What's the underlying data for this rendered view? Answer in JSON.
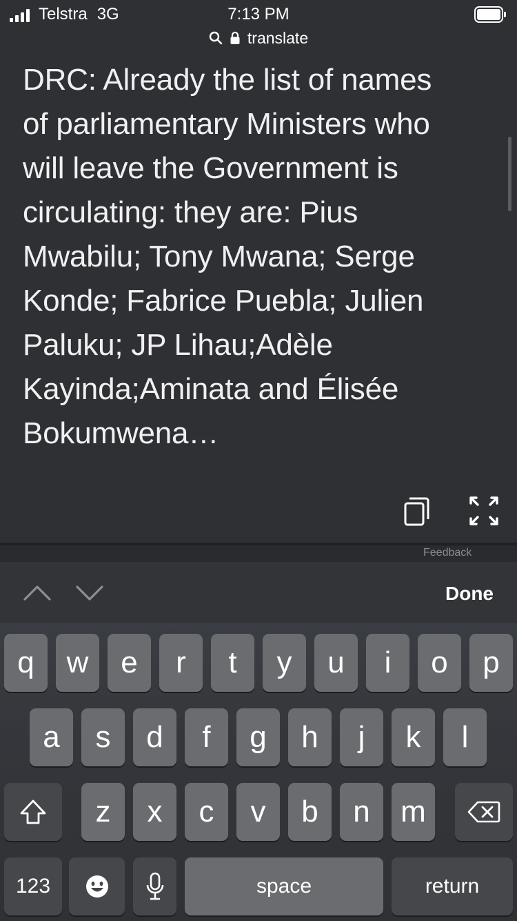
{
  "status_bar": {
    "carrier": "Telstra",
    "network": "3G",
    "time": "7:13 PM",
    "url": "translate"
  },
  "translation": {
    "text": "DRC: Already the list of names of parliamentary Ministers who will leave the Government is circulating: they are: Pius Mwabilu; Tony Mwana; Serge Konde; Fabrice Puebla; Julien Paluku; JP Lihau;Adèle Kayinda;Aminata and Élisée Bokumwena…",
    "lines": [
      "DRC: Already the list of names",
      "of parliamentary Ministers who",
      "will leave the Government is",
      "circulating: they are: Pius",
      "Mwabilu; Tony Mwana; Serge",
      "Konde; Fabrice Puebla; Julien",
      "Paluku; JP Lihau;Adèle",
      "Kayinda;Aminata and Élisée",
      "Bokumwena…"
    ],
    "feedback_partial": "Feedback"
  },
  "accessory_bar": {
    "done_label": "Done"
  },
  "keyboard": {
    "row1": [
      "q",
      "w",
      "e",
      "r",
      "t",
      "y",
      "u",
      "i",
      "o",
      "p"
    ],
    "row2": [
      "a",
      "s",
      "d",
      "f",
      "g",
      "h",
      "j",
      "k",
      "l"
    ],
    "row3": [
      "z",
      "x",
      "c",
      "v",
      "b",
      "n",
      "m"
    ],
    "numbers_label": "123",
    "space_label": "space",
    "return_label": "return"
  },
  "icons": {
    "signal": "signal-bars-icon",
    "battery": "battery-icon",
    "search": "search-icon",
    "lock": "lock-icon",
    "copy": "copy-icon",
    "fullscreen": "fullscreen-icon",
    "prev": "chevron-up-icon",
    "next": "chevron-down-icon",
    "shift": "shift-icon",
    "delete": "backspace-icon",
    "emoji": "emoji-icon",
    "mic": "microphone-icon"
  },
  "colors": {
    "background": "#2f3034",
    "key": "#6b6c70",
    "key_dark": "#46474a",
    "text": "#f0f0f2"
  }
}
